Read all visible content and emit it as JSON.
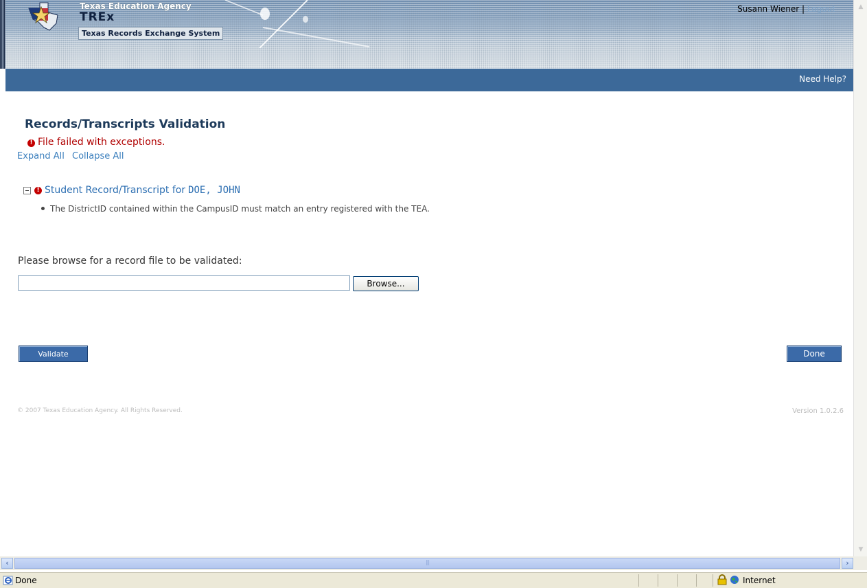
{
  "header": {
    "agency": "Texas Education Agency",
    "app_short_name": "TREx",
    "app_full_name": "Texas Records Exchange System",
    "user_name": "Susann Wiener",
    "separator": "|",
    "logout_label": "Logout",
    "need_help_label": "Need Help?"
  },
  "main": {
    "page_title": "Records/Transcripts Validation",
    "status_icon": "exclamation-icon",
    "status_message": "File failed with exceptions.",
    "expand_all_label": "Expand All",
    "collapse_all_label": "Collapse All",
    "records": [
      {
        "title_prefix": "Student Record/Transcript for",
        "student_name": "DOE, JOHN",
        "exceptions": [
          "The DistrictID contained within the CampusID must match an entry registered with the TEA."
        ]
      }
    ],
    "browse_prompt": "Please browse for a record file to be validated:",
    "file_input_value": "",
    "browse_button_label": "Browse...",
    "validate_button_label": "Validate",
    "done_button_label": "Done"
  },
  "footer": {
    "copyright": "© 2007 Texas Education Agency. All Rights Reserved.",
    "version": "Version 1.0.2.6"
  },
  "browser": {
    "status_text": "Done",
    "zone_text": "Internet"
  },
  "colors": {
    "nav_bar": "#3c6999",
    "title": "#1d3a5a",
    "error": "#b00000",
    "link": "#3b7fbd",
    "button": "#3b6aa8"
  }
}
